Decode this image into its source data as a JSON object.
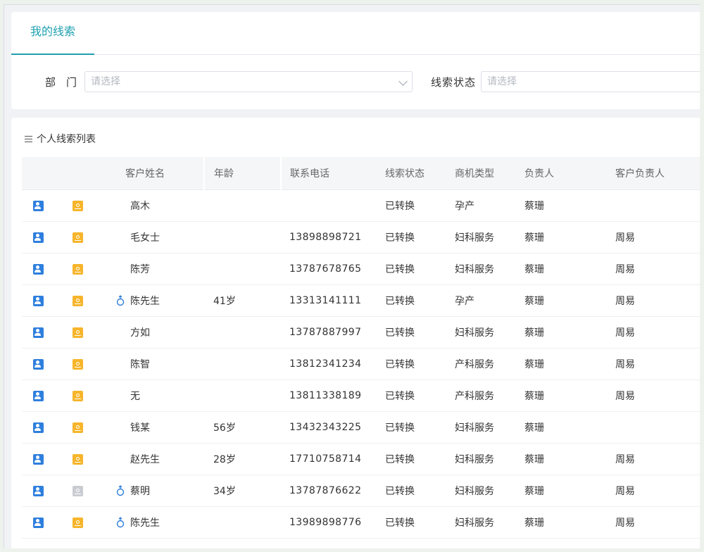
{
  "tab": {
    "label": "我的线索"
  },
  "filters": {
    "dept_label": "部门",
    "dept_placeholder": "请选择",
    "status_label": "线索状态",
    "status_placeholder": "请选择"
  },
  "list": {
    "title": "个人线索列表",
    "columns": [
      "客户姓名",
      "年龄",
      "联系电话",
      "线索状态",
      "商机类型",
      "负责人",
      "客户负责人"
    ],
    "rows": [
      {
        "male": false,
        "bulb_on": true,
        "name": "高木",
        "age": "",
        "phone": "",
        "status": "已转换",
        "type": "孕产",
        "owner": "蔡珊",
        "cowner": ""
      },
      {
        "male": false,
        "bulb_on": true,
        "name": "毛女士",
        "age": "",
        "phone": "13898898721",
        "status": "已转换",
        "type": "妇科服务",
        "owner": "蔡珊",
        "cowner": "周易"
      },
      {
        "male": false,
        "bulb_on": true,
        "name": "陈芳",
        "age": "",
        "phone": "13787678765",
        "status": "已转换",
        "type": "妇科服务",
        "owner": "蔡珊",
        "cowner": "周易"
      },
      {
        "male": true,
        "bulb_on": true,
        "name": "陈先生",
        "age": "41岁",
        "phone": "13313141111",
        "status": "已转换",
        "type": "孕产",
        "owner": "蔡珊",
        "cowner": "周易"
      },
      {
        "male": false,
        "bulb_on": true,
        "name": "方如",
        "age": "",
        "phone": "13787887997",
        "status": "已转换",
        "type": "妇科服务",
        "owner": "蔡珊",
        "cowner": "周易"
      },
      {
        "male": false,
        "bulb_on": true,
        "name": "陈智",
        "age": "",
        "phone": "13812341234",
        "status": "已转换",
        "type": "产科服务",
        "owner": "蔡珊",
        "cowner": "周易"
      },
      {
        "male": false,
        "bulb_on": true,
        "name": "无",
        "age": "",
        "phone": "13811338189",
        "status": "已转换",
        "type": "产科服务",
        "owner": "蔡珊",
        "cowner": "周易"
      },
      {
        "male": false,
        "bulb_on": true,
        "name": "钱某",
        "age": "56岁",
        "phone": "13432343225",
        "status": "已转换",
        "type": "妇科服务",
        "owner": "蔡珊",
        "cowner": ""
      },
      {
        "male": false,
        "bulb_on": true,
        "name": "赵先生",
        "age": "28岁",
        "phone": "17710758714",
        "status": "已转换",
        "type": "妇科服务",
        "owner": "蔡珊",
        "cowner": "周易"
      },
      {
        "male": true,
        "bulb_on": false,
        "name": "蔡明",
        "age": "34岁",
        "phone": "13787876622",
        "status": "已转换",
        "type": "妇科服务",
        "owner": "蔡珊",
        "cowner": "周易"
      },
      {
        "male": true,
        "bulb_on": true,
        "name": "陈先生",
        "age": "",
        "phone": "13989898776",
        "status": "已转换",
        "type": "妇科服务",
        "owner": "蔡珊",
        "cowner": "周易"
      }
    ]
  }
}
